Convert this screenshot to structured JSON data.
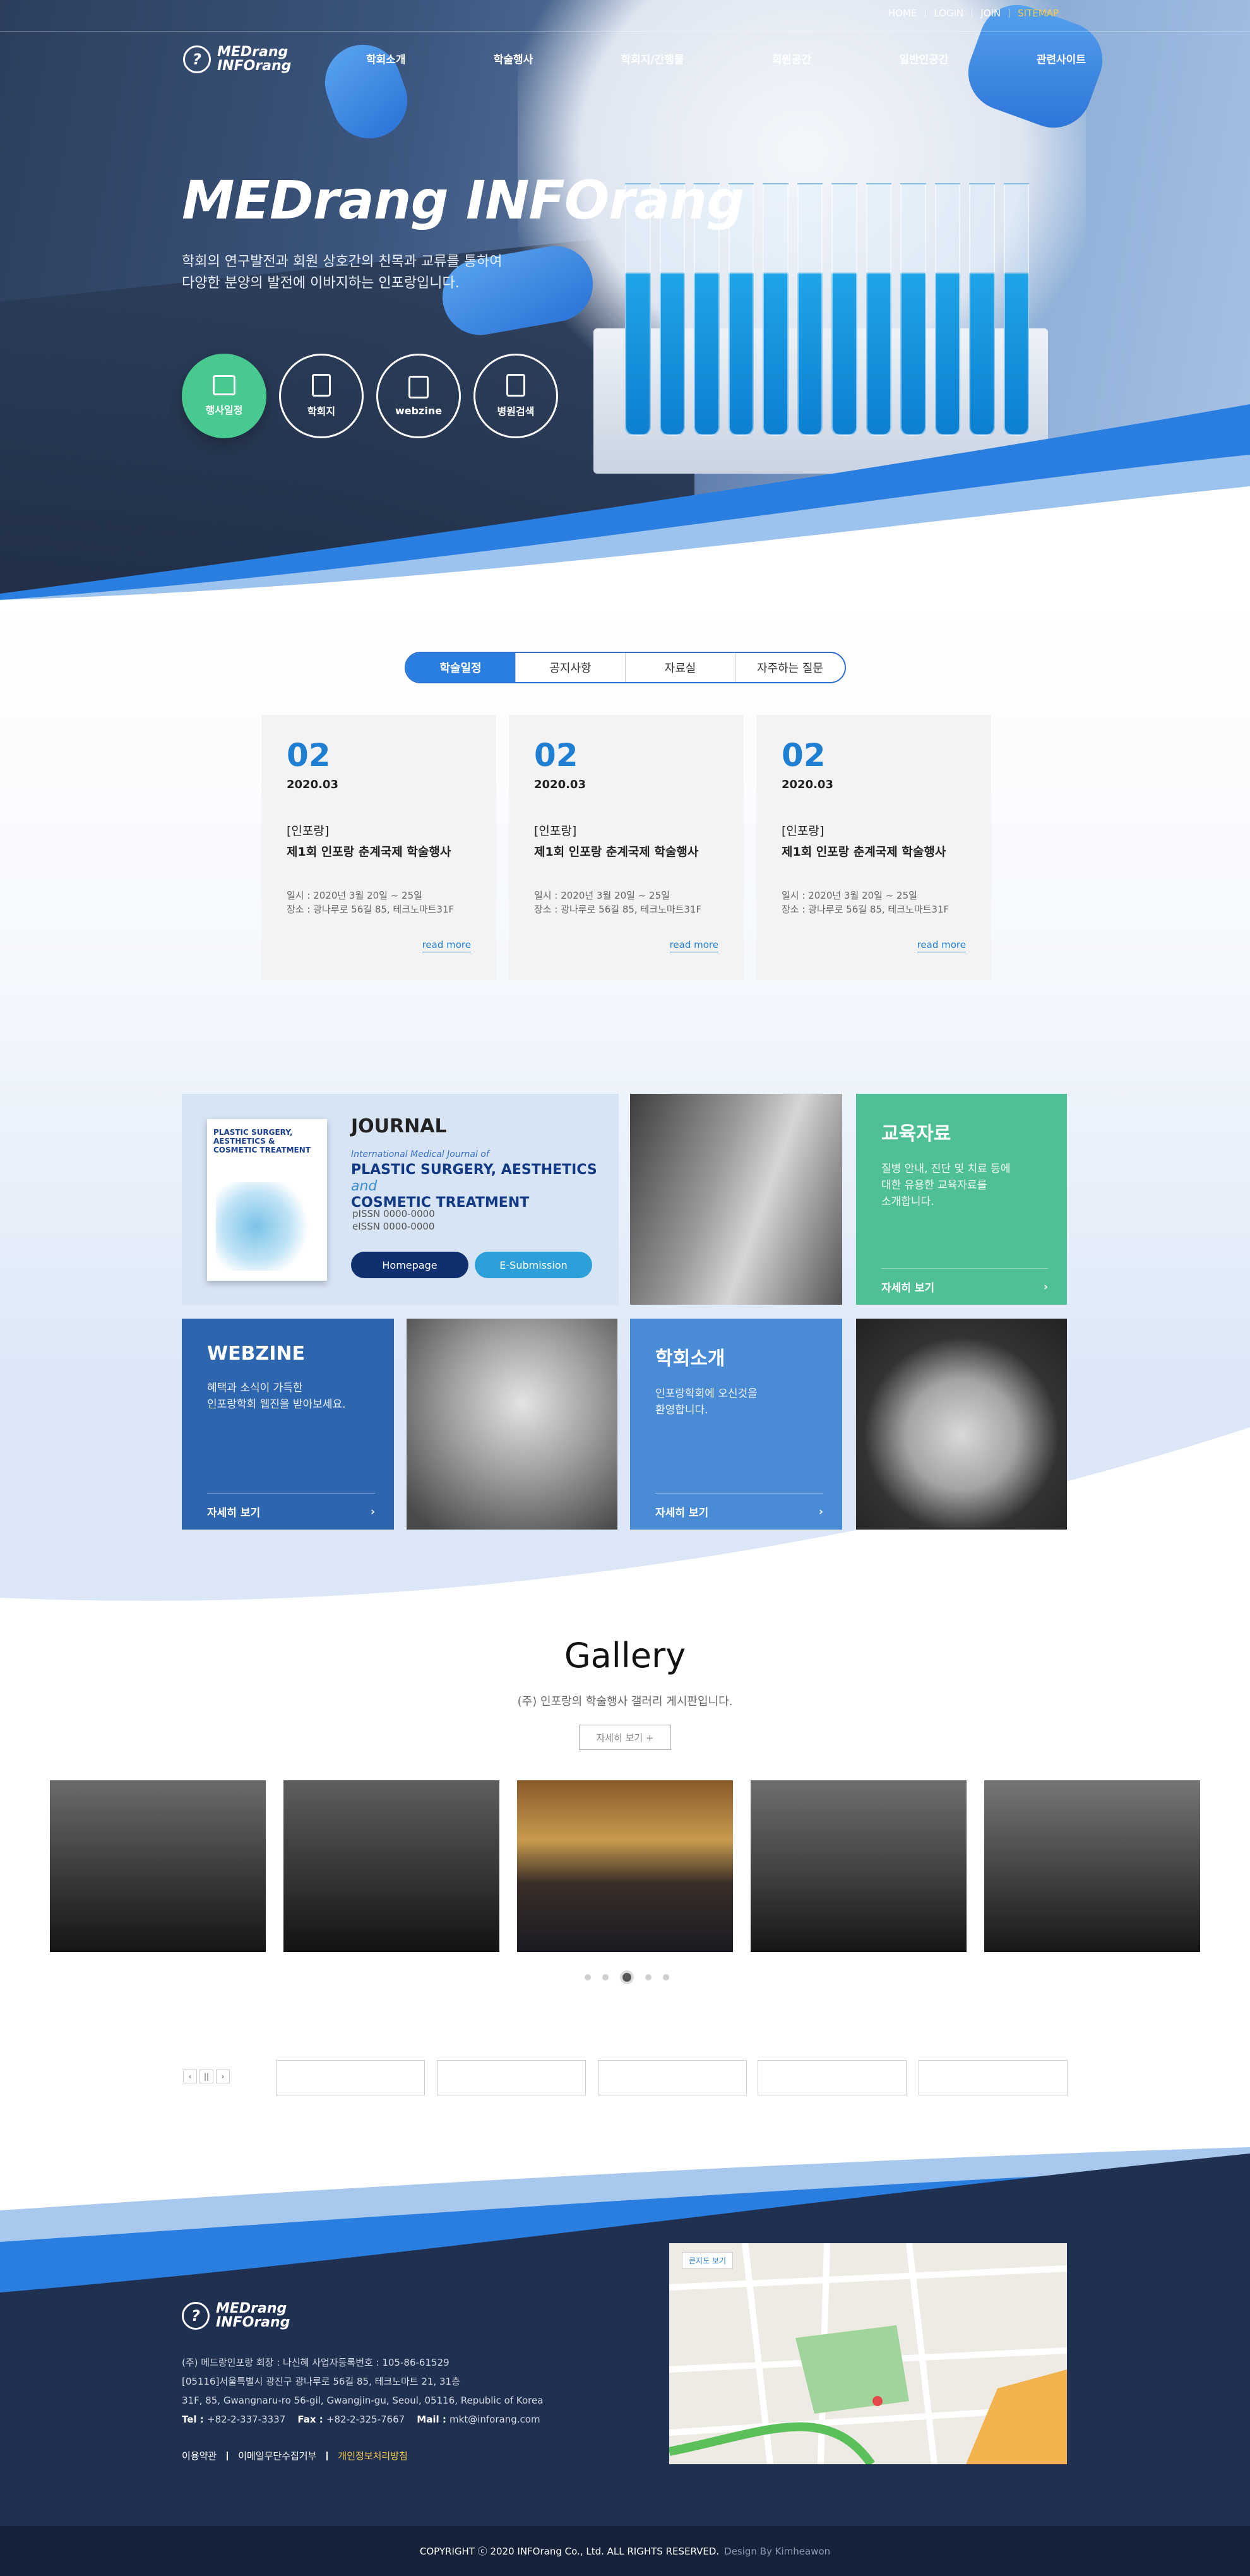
{
  "header": {
    "top_links": [
      "HOME",
      "LOGIN",
      "JOIN",
      "SITEMAP"
    ],
    "logo": [
      "MEDrang",
      "INFOrang"
    ],
    "gnb": [
      "학회소개",
      "학술행사",
      "학회지/간행물",
      "회원공간",
      "일반인공간",
      "관련사이트"
    ]
  },
  "hero": {
    "title": "MEDrang INFOrang",
    "desc_line1": "학회의 연구발전과 회원 상호간의 친목과 교류를 통하여",
    "desc_line2": "다양한 분양의 발전에 이바지하는 인포랑입니다.",
    "quick": [
      {
        "label": "행사일정",
        "icon": "calendar-icon"
      },
      {
        "label": "학회지",
        "icon": "journal-icon"
      },
      {
        "label": "webzine",
        "icon": "webzine-icon"
      },
      {
        "label": "병원검색",
        "icon": "hospital-search-icon"
      }
    ]
  },
  "board": {
    "tabs": [
      "학술일정",
      "공지사항",
      "자료실",
      "자주하는 질문"
    ],
    "cards": [
      {
        "day": "02",
        "ym": "2020.03",
        "cat": "[인포랑]",
        "title": "제1회 인포랑 춘계국제 학술행사",
        "date": "일시 : 2020년 3월 20일 ~ 25일",
        "place": "장소 : 광나루로 56길 85, 테크노마트31F",
        "more": "read more"
      },
      {
        "day": "02",
        "ym": "2020.03",
        "cat": "[인포랑]",
        "title": "제1회 인포랑 춘계국제 학술행사",
        "date": "일시 : 2020년 3월 20일 ~ 25일",
        "place": "장소 : 광나루로 56길 85, 테크노마트31F",
        "more": "read more"
      },
      {
        "day": "02",
        "ym": "2020.03",
        "cat": "[인포랑]",
        "title": "제1회 인포랑 춘계국제 학술행사",
        "date": "일시 : 2020년 3월 20일 ~ 25일",
        "place": "장소 : 광나루로 56길 85, 테크노마트31F",
        "more": "read more"
      }
    ]
  },
  "journal": {
    "title": "JOURNAL",
    "sub": "International Medical Journal of",
    "name_line1": "PLASTIC SURGERY, AESTHETICS",
    "name_and": "and",
    "name_line2": "COSMETIC TREATMENT",
    "cover_title": "PLASTIC SURGERY, AESTHETICS & COSMETIC TREATMENT",
    "pissn": "pISSN 0000-0000",
    "eissn": "eISSN 0000-0000",
    "btn_home": "Homepage",
    "btn_submit": "E-Submission"
  },
  "edu": {
    "title": "교육자료",
    "desc1": "질병 안내, 진단 및 치료 등에",
    "desc2": "대한 유용한 교육자료를",
    "desc3": "소개합니다.",
    "more": "자세히 보기"
  },
  "webzine": {
    "title": "WEBZINE",
    "desc1": "혜택과 소식이 가득한",
    "desc2": "인포랑학회 웹진을 받아보세요.",
    "more": "자세히 보기"
  },
  "society": {
    "title": "학회소개",
    "desc1": "인포랑학회에 오신것을",
    "desc2": "환영합니다.",
    "more": "자세히 보기"
  },
  "gallery": {
    "title": "Gallery",
    "desc": "(주) 인포랑의 학술행사 갤러리 게시판입니다.",
    "more": "자세히 보기 +"
  },
  "partners": {
    "ctl": [
      "‹",
      "||",
      "›"
    ]
  },
  "footer": {
    "logo": [
      "MEDrang",
      "INFOrang"
    ],
    "line1": "(주) 메드랑인포랑     회장 : 나신혜     사업자등록번호 : 105-86-61529",
    "line2": "[05116]서울특별시 광진구 광나루로 56길 85, 테크노마트 21, 31층",
    "line3": "31F, 85, Gwangnaru-ro 56-gil, Gwangjin-gu, Seoul, 05116, Republic of Korea",
    "tel_label": "Tel : ",
    "tel": "+82-2-337-3337",
    "fax_label": "Fax : ",
    "fax": "+82-2-325-7667",
    "mail_label": "Mail : ",
    "mail": "mkt@inforang.com",
    "links": [
      "이용약관",
      "이메일무단수집거부",
      "개인정보처리방침"
    ],
    "map_label": "큰지도 보기",
    "copyright": "COPYRIGHT ⓒ 2020 INFOrang Co., Ltd. ALL RIGHTS RESERVED.",
    "design": "Design By Kimheawon"
  },
  "colors": {
    "primary": "#2a7ee0",
    "green": "#4fc095",
    "navy": "#1f3050",
    "webzine": "#2d66ae",
    "society": "#4a8bd6"
  }
}
